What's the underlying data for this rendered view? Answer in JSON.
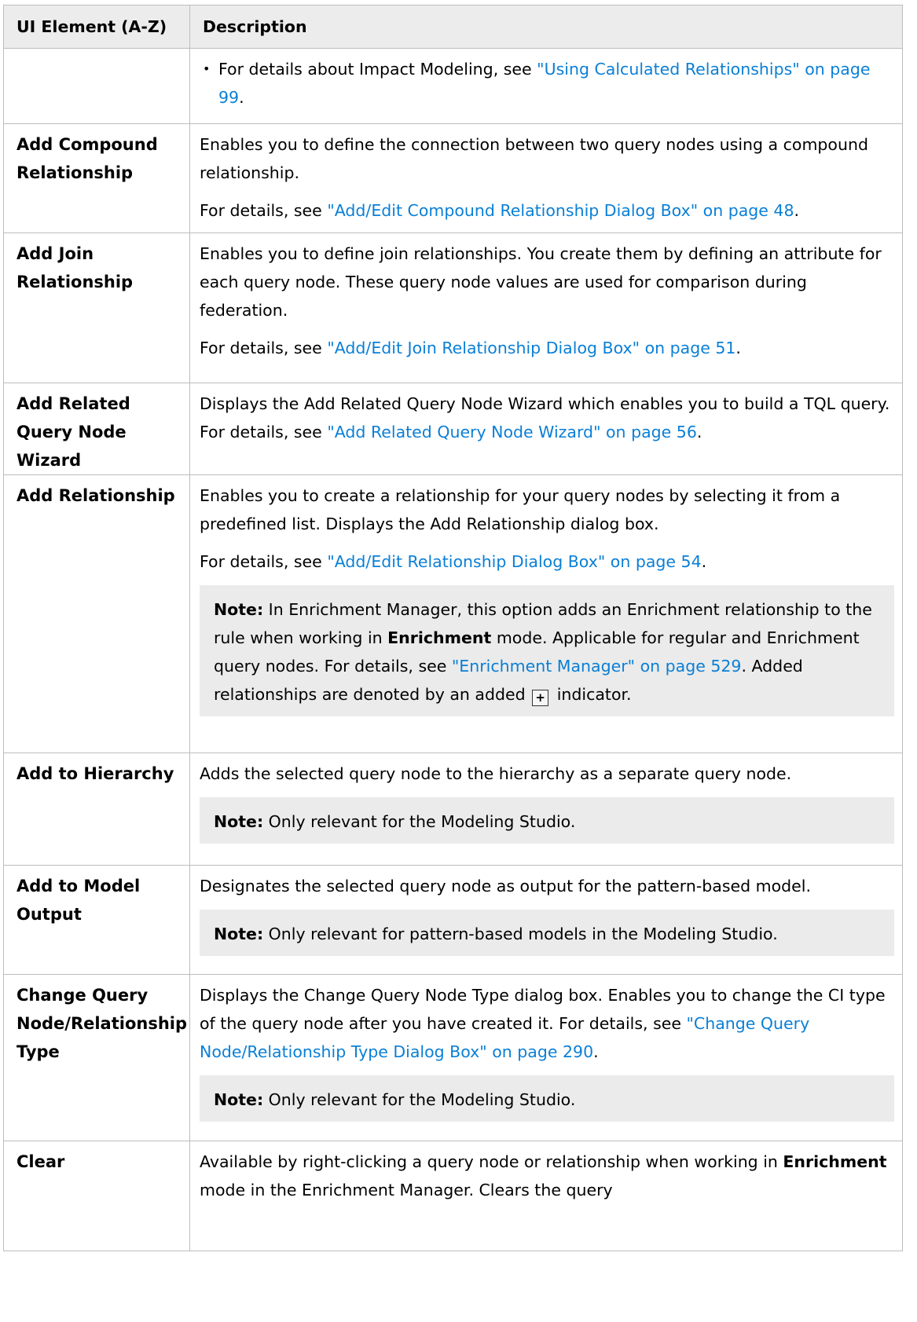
{
  "table": {
    "headers": [
      "UI Element (A-Z)",
      "Description"
    ]
  },
  "rows": {
    "r0": {
      "bullet_text": "For details about Impact Modeling, see ",
      "bullet_link": "\"Using Calculated Relationships\" on page 99",
      "bullet_end": "."
    },
    "r1": {
      "name": "Add Compound Relationship",
      "p1": "Enables you to define the connection between two query nodes using a compound relationship.",
      "p2_text": "For details, see ",
      "p2_link": "\"Add/Edit Compound Relationship Dialog Box\" on page 48",
      "p2_end": "."
    },
    "r2": {
      "name": "Add Join Relationship",
      "p1": "Enables you to define join relationships. You create them by defining an attribute for each query node. These query node values are used for comparison during federation.",
      "p2_text": "For details, see ",
      "p2_link": "\"Add/Edit Join Relationship Dialog Box\" on page 51",
      "p2_end": "."
    },
    "r3": {
      "name": "Add Related Query Node Wizard",
      "p1_text": "Displays the Add Related Query Node Wizard which enables you to build a TQL query. For details, see ",
      "p1_link": "\"Add Related Query Node Wizard\" on page 56",
      "p1_end": "."
    },
    "r4": {
      "name": "Add Relationship",
      "p1": "Enables you to create a relationship for your query nodes by selecting it from a predefined list. Displays the Add Relationship dialog box.",
      "p2_text": "For details, see ",
      "p2_link": "\"Add/Edit Relationship Dialog Box\" on page 54",
      "p2_end": ".",
      "note_label": "Note:",
      "note_t1": " In Enrichment Manager, this option adds an Enrichment relationship to the rule when working in ",
      "note_bold": "Enrichment",
      "note_t2": " mode. Applicable for regular and Enrichment query nodes. For details, see ",
      "note_link": "\"Enrichment Manager\" on page 529",
      "note_t3": ". Added relationships are denoted by an added ",
      "note_icon": "plus-box-icon",
      "note_t4": " indicator."
    },
    "r5": {
      "name": "Add to Hierarchy",
      "p1": "Adds the selected query node to the hierarchy as a separate query node.",
      "note_label": "Note:",
      "note_text": " Only relevant for the Modeling Studio."
    },
    "r6": {
      "name": "Add to Model Output",
      "p1": "Designates the selected query node as output for the pattern-based model.",
      "note_label": "Note:",
      "note_text": " Only relevant for pattern-based models in the Modeling Studio."
    },
    "r7": {
      "name": "Change Query Node/Relationship Type",
      "p1_text": "Displays the Change Query Node Type dialog box. Enables you to change the CI type of the query node after you have created it. For details, see ",
      "p1_link": "\"Change Query Node/Relationship Type Dialog Box\" on page 290",
      "p1_end": ".",
      "note_label": "Note:",
      "note_text": " Only relevant for the Modeling Studio."
    },
    "r8": {
      "name": "Clear",
      "p1_t1": "Available by right-clicking a query node or relationship when working in ",
      "p1_bold": "Enrichment",
      "p1_t2": " mode in the Enrichment Manager. Clears the query"
    }
  },
  "colors": {
    "link": "#0a7fd6",
    "header_bg": "#ececec",
    "note_bg": "#ebebeb",
    "border": "#bdbdbd"
  }
}
